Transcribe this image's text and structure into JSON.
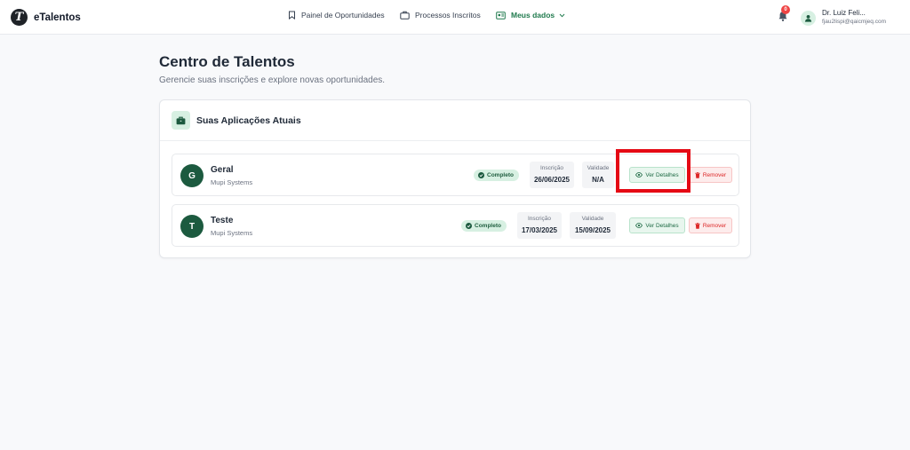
{
  "header": {
    "logo_letter": "T",
    "logo_text": "eTalentos",
    "nav": [
      {
        "label": "Painel de Oportunidades",
        "icon": "bookmark-icon"
      },
      {
        "label": "Processos Inscritos",
        "icon": "briefcase-icon"
      },
      {
        "label": "Meus dados",
        "icon": "id-card-icon",
        "active": true
      }
    ],
    "notifications_count": "0",
    "user": {
      "name": "Dr. Luiz Feli...",
      "email": "fjau2lispi@qaicmjeq.com"
    }
  },
  "page": {
    "title": "Centro de Talentos",
    "subtitle": "Gerencie suas inscrições e explore novas oportunidades."
  },
  "card": {
    "title": "Suas Aplicações Atuais",
    "icon": "briefcase-icon",
    "applications": [
      {
        "initial": "G",
        "title": "Geral",
        "company": "Mupi Systems",
        "status": "Completo",
        "inscricao_label": "Inscrição",
        "inscricao": "26/06/2025",
        "validade_label": "Validade",
        "validade": "N/A",
        "details_label": "Ver Detalhes",
        "remove_label": "Remover"
      },
      {
        "initial": "T",
        "title": "Teste",
        "company": "Mupi Systems",
        "status": "Completo",
        "inscricao_label": "Inscrição",
        "inscricao": "17/03/2025",
        "validade_label": "Validade",
        "validade": "15/09/2025",
        "details_label": "Ver Detalhes",
        "remove_label": "Remover"
      }
    ]
  },
  "colors": {
    "brand_green": "#1c5a3f",
    "accent_light_green": "#d7f0e2",
    "remove_red": "#dc2626",
    "highlight_red": "#e50914"
  }
}
